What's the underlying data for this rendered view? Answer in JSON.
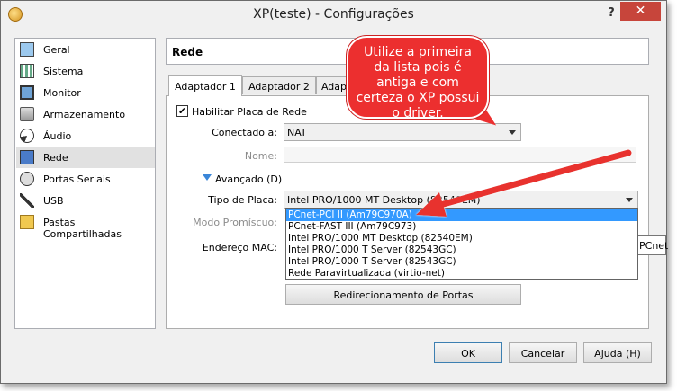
{
  "window": {
    "title": "XP(teste) - Configurações",
    "help_label": "?",
    "close_label": "✕"
  },
  "sidebar": {
    "items": [
      {
        "label": "Geral",
        "icon": "general-icon"
      },
      {
        "label": "Sistema",
        "icon": "system-icon"
      },
      {
        "label": "Monitor",
        "icon": "monitor-icon"
      },
      {
        "label": "Armazenamento",
        "icon": "storage-icon"
      },
      {
        "label": "Áudio",
        "icon": "audio-icon"
      },
      {
        "label": "Rede",
        "icon": "network-icon",
        "selected": true
      },
      {
        "label": "Portas Seriais",
        "icon": "serial-ports-icon"
      },
      {
        "label": "USB",
        "icon": "usb-icon"
      },
      {
        "label": "Pastas Compartilhadas",
        "icon": "shared-folders-icon"
      }
    ]
  },
  "section": {
    "title": "Rede"
  },
  "tabs": [
    {
      "label": "Adaptador 1",
      "active": true
    },
    {
      "label": "Adaptador 2",
      "active": false
    },
    {
      "label": "Adap",
      "active": false
    }
  ],
  "form": {
    "enable_label": "Habilitar Placa de Rede",
    "enable_checked": "✔",
    "attached_label": "Conectado a:",
    "attached_value": "NAT",
    "name_label": "Nome:",
    "name_value": "",
    "advanced_label": "Avançado (D)",
    "adapter_type_label": "Tipo de Placa:",
    "adapter_type_value": "Intel PRO/1000 MT Desktop (82540EM)",
    "promisc_label": "Modo Promíscuo:",
    "mac_label": "Endereço MAC:",
    "port_forward_button": "Redirecionamento de Portas"
  },
  "dropdown": {
    "options": [
      "PCnet-PCI II (Am79C970A)",
      "PCnet-FAST III (Am79C973)",
      "Intel PRO/1000 MT Desktop (82540EM)",
      "Intel PRO/1000 T Server (82543GC)",
      "Intel PRO/1000 T Server (82543GC)",
      "Rede Paravirtualizada (virtio-net)"
    ],
    "highlighted": "PCnet-PCI II (Am79C970A)"
  },
  "tooltip_peek": "PCnet",
  "callout": {
    "text": "Utilize a primeira da lista pois é antiga e com certeza o XP possui o driver.",
    "color": "#ec2f2f"
  },
  "buttons": {
    "ok": "OK",
    "cancel": "Cancelar",
    "help": "Ajuda (H)"
  }
}
